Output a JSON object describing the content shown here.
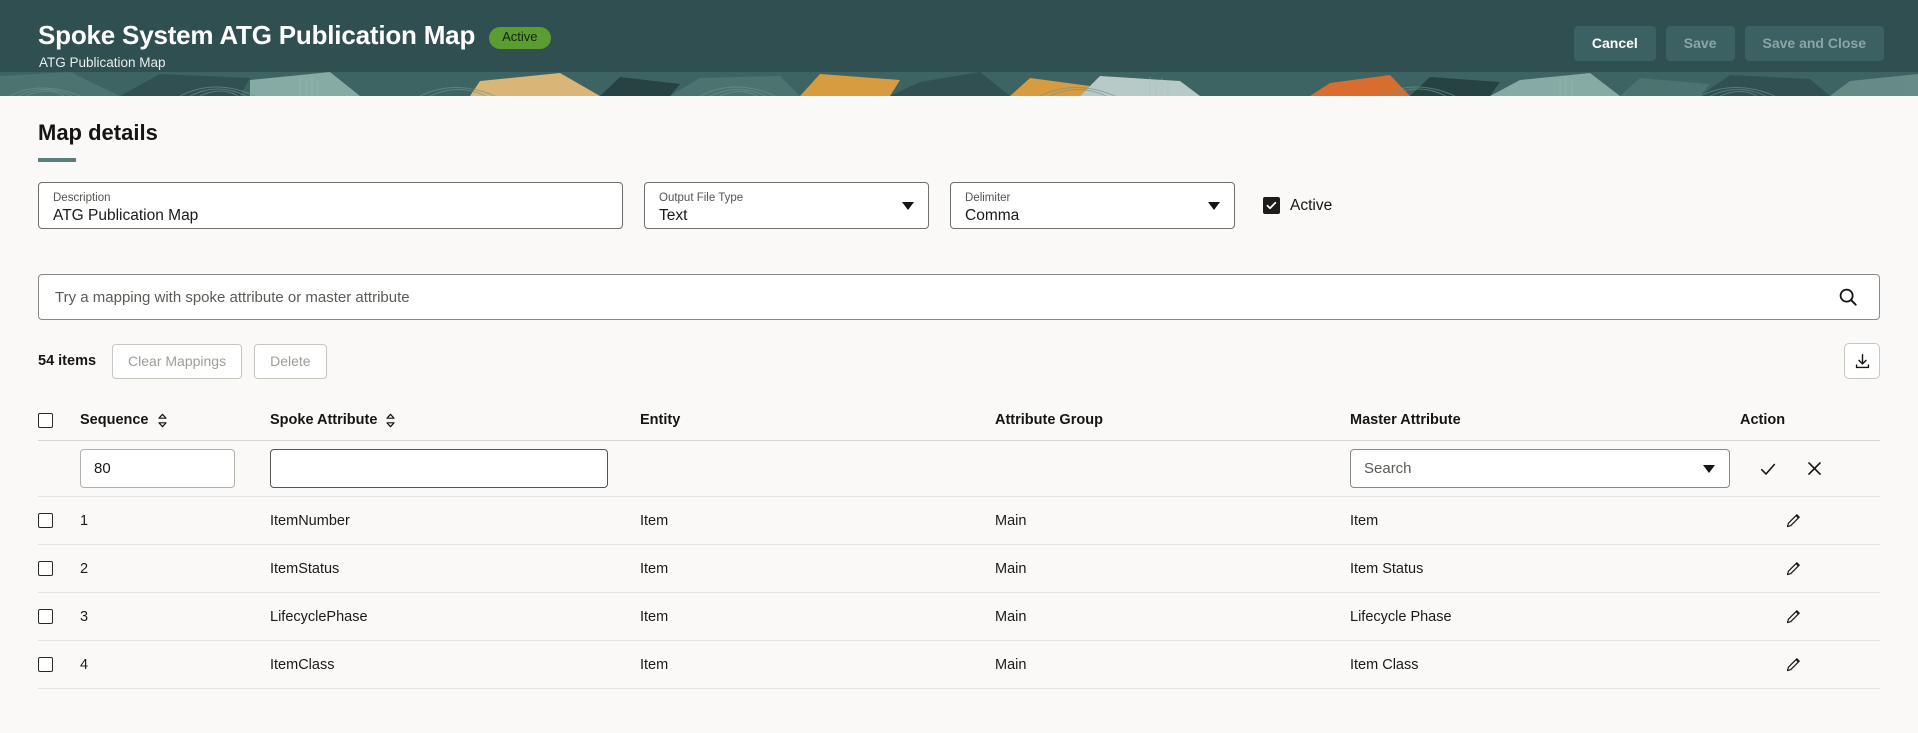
{
  "header": {
    "title": "Spoke System ATG Publication Map",
    "status_badge": "Active",
    "subtitle": "ATG Publication Map",
    "bg_color": "#2f4f50",
    "badge_color": "#5a9e32",
    "buttons": [
      {
        "label": "Cancel",
        "state": "enabled"
      },
      {
        "label": "Save",
        "state": "disabled"
      },
      {
        "label": "Save and Close",
        "state": "disabled"
      }
    ]
  },
  "main": {
    "section_title": "Map details",
    "accent_color": "#5c7d7c",
    "fields": {
      "description": {
        "label": "Description",
        "value": "ATG Publication Map"
      },
      "output_file_type": {
        "label": "Output File Type",
        "value": "Text"
      },
      "delimiter": {
        "label": "Delimiter",
        "value": "Comma"
      },
      "active": {
        "label": "Active",
        "checked": true
      }
    },
    "search": {
      "placeholder": "Try a mapping with spoke attribute or master attribute",
      "value": "",
      "icon": "search-icon"
    },
    "toolbar": {
      "item_count": "54 items",
      "clear_mappings_label": "Clear Mappings",
      "delete_label": "Delete",
      "export_icon": "download-icon"
    },
    "table": {
      "columns": [
        {
          "key": "select",
          "label": "",
          "sortable": false
        },
        {
          "key": "sequence",
          "label": "Sequence",
          "sortable": true
        },
        {
          "key": "spoke_attribute",
          "label": "Spoke Attribute",
          "sortable": true
        },
        {
          "key": "entity",
          "label": "Entity",
          "sortable": false
        },
        {
          "key": "attribute_group",
          "label": "Attribute Group",
          "sortable": false
        },
        {
          "key": "master_attribute",
          "label": "Master Attribute",
          "sortable": false
        },
        {
          "key": "action",
          "label": "Action",
          "sortable": false
        }
      ],
      "editor_row": {
        "sequence_value": "80",
        "spoke_attribute_value": "",
        "entity_value": "",
        "attribute_group_value": "",
        "master_attribute_placeholder": "Search",
        "confirm_icon": "check-icon",
        "cancel_icon": "close-icon"
      },
      "rows": [
        {
          "sequence": "1",
          "spoke_attribute": "ItemNumber",
          "entity": "Item",
          "attribute_group": "Main",
          "master_attribute": "Item",
          "action_icon": "pencil-icon"
        },
        {
          "sequence": "2",
          "spoke_attribute": "ItemStatus",
          "entity": "Item",
          "attribute_group": "Main",
          "master_attribute": "Item Status",
          "action_icon": "pencil-icon"
        },
        {
          "sequence": "3",
          "spoke_attribute": "LifecyclePhase",
          "entity": "Item",
          "attribute_group": "Main",
          "master_attribute": "Lifecycle Phase",
          "action_icon": "pencil-icon"
        },
        {
          "sequence": "4",
          "spoke_attribute": "ItemClass",
          "entity": "Item",
          "attribute_group": "Main",
          "master_attribute": "Item Class",
          "action_icon": "pencil-icon"
        }
      ]
    }
  }
}
